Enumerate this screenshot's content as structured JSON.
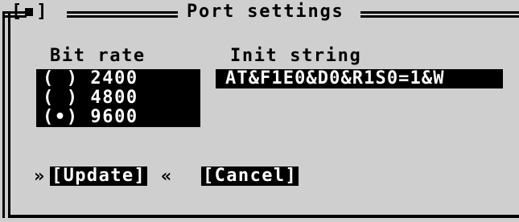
{
  "dialog": {
    "title": "Port settings",
    "close_box": "[■]"
  },
  "bit_rate": {
    "label": "Bit rate",
    "options": [
      {
        "label": "( ) 2400"
      },
      {
        "label": "( ) 4800"
      },
      {
        "label": "(•) 9600"
      }
    ],
    "selected": "9600"
  },
  "init_string": {
    "label": "Init string",
    "value": "AT&F1E0&D0&R1S0=1&W",
    "cursor_marker": "<"
  },
  "buttons": {
    "update_label": "[Update]",
    "cancel_label": "[Cancel]",
    "focus_left": "»",
    "focus_right": "«"
  }
}
